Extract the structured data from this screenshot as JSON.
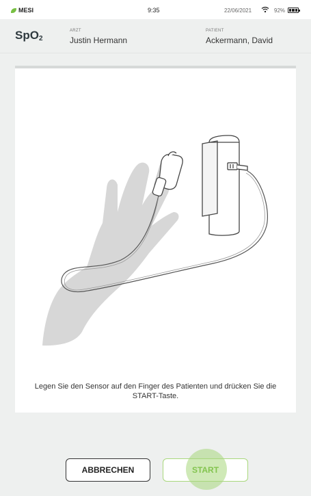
{
  "status_bar": {
    "brand": "MESI",
    "time": "9:35",
    "date": "22/06/2021",
    "battery": "92%",
    "icons": [
      "leaf-logo-icon",
      "wifi-icon",
      "battery-icon"
    ]
  },
  "header": {
    "mode_main": "SpO",
    "mode_sub": "2",
    "doctor_label": "ARZT",
    "doctor_name": "Justin Hermann",
    "patient_label": "PATIENT",
    "patient_name": "Ackermann, David"
  },
  "card": {
    "illustration": "hand-with-pulse-oximeter-sensor-illustration",
    "instruction": "Legen Sie den Sensor auf den Finger des Patienten und drücken Sie die START-Taste."
  },
  "buttons": {
    "cancel": "ABBRECHEN",
    "start": "START"
  },
  "colors": {
    "accent_green": "#83c44f",
    "background": "#eef0ef"
  }
}
